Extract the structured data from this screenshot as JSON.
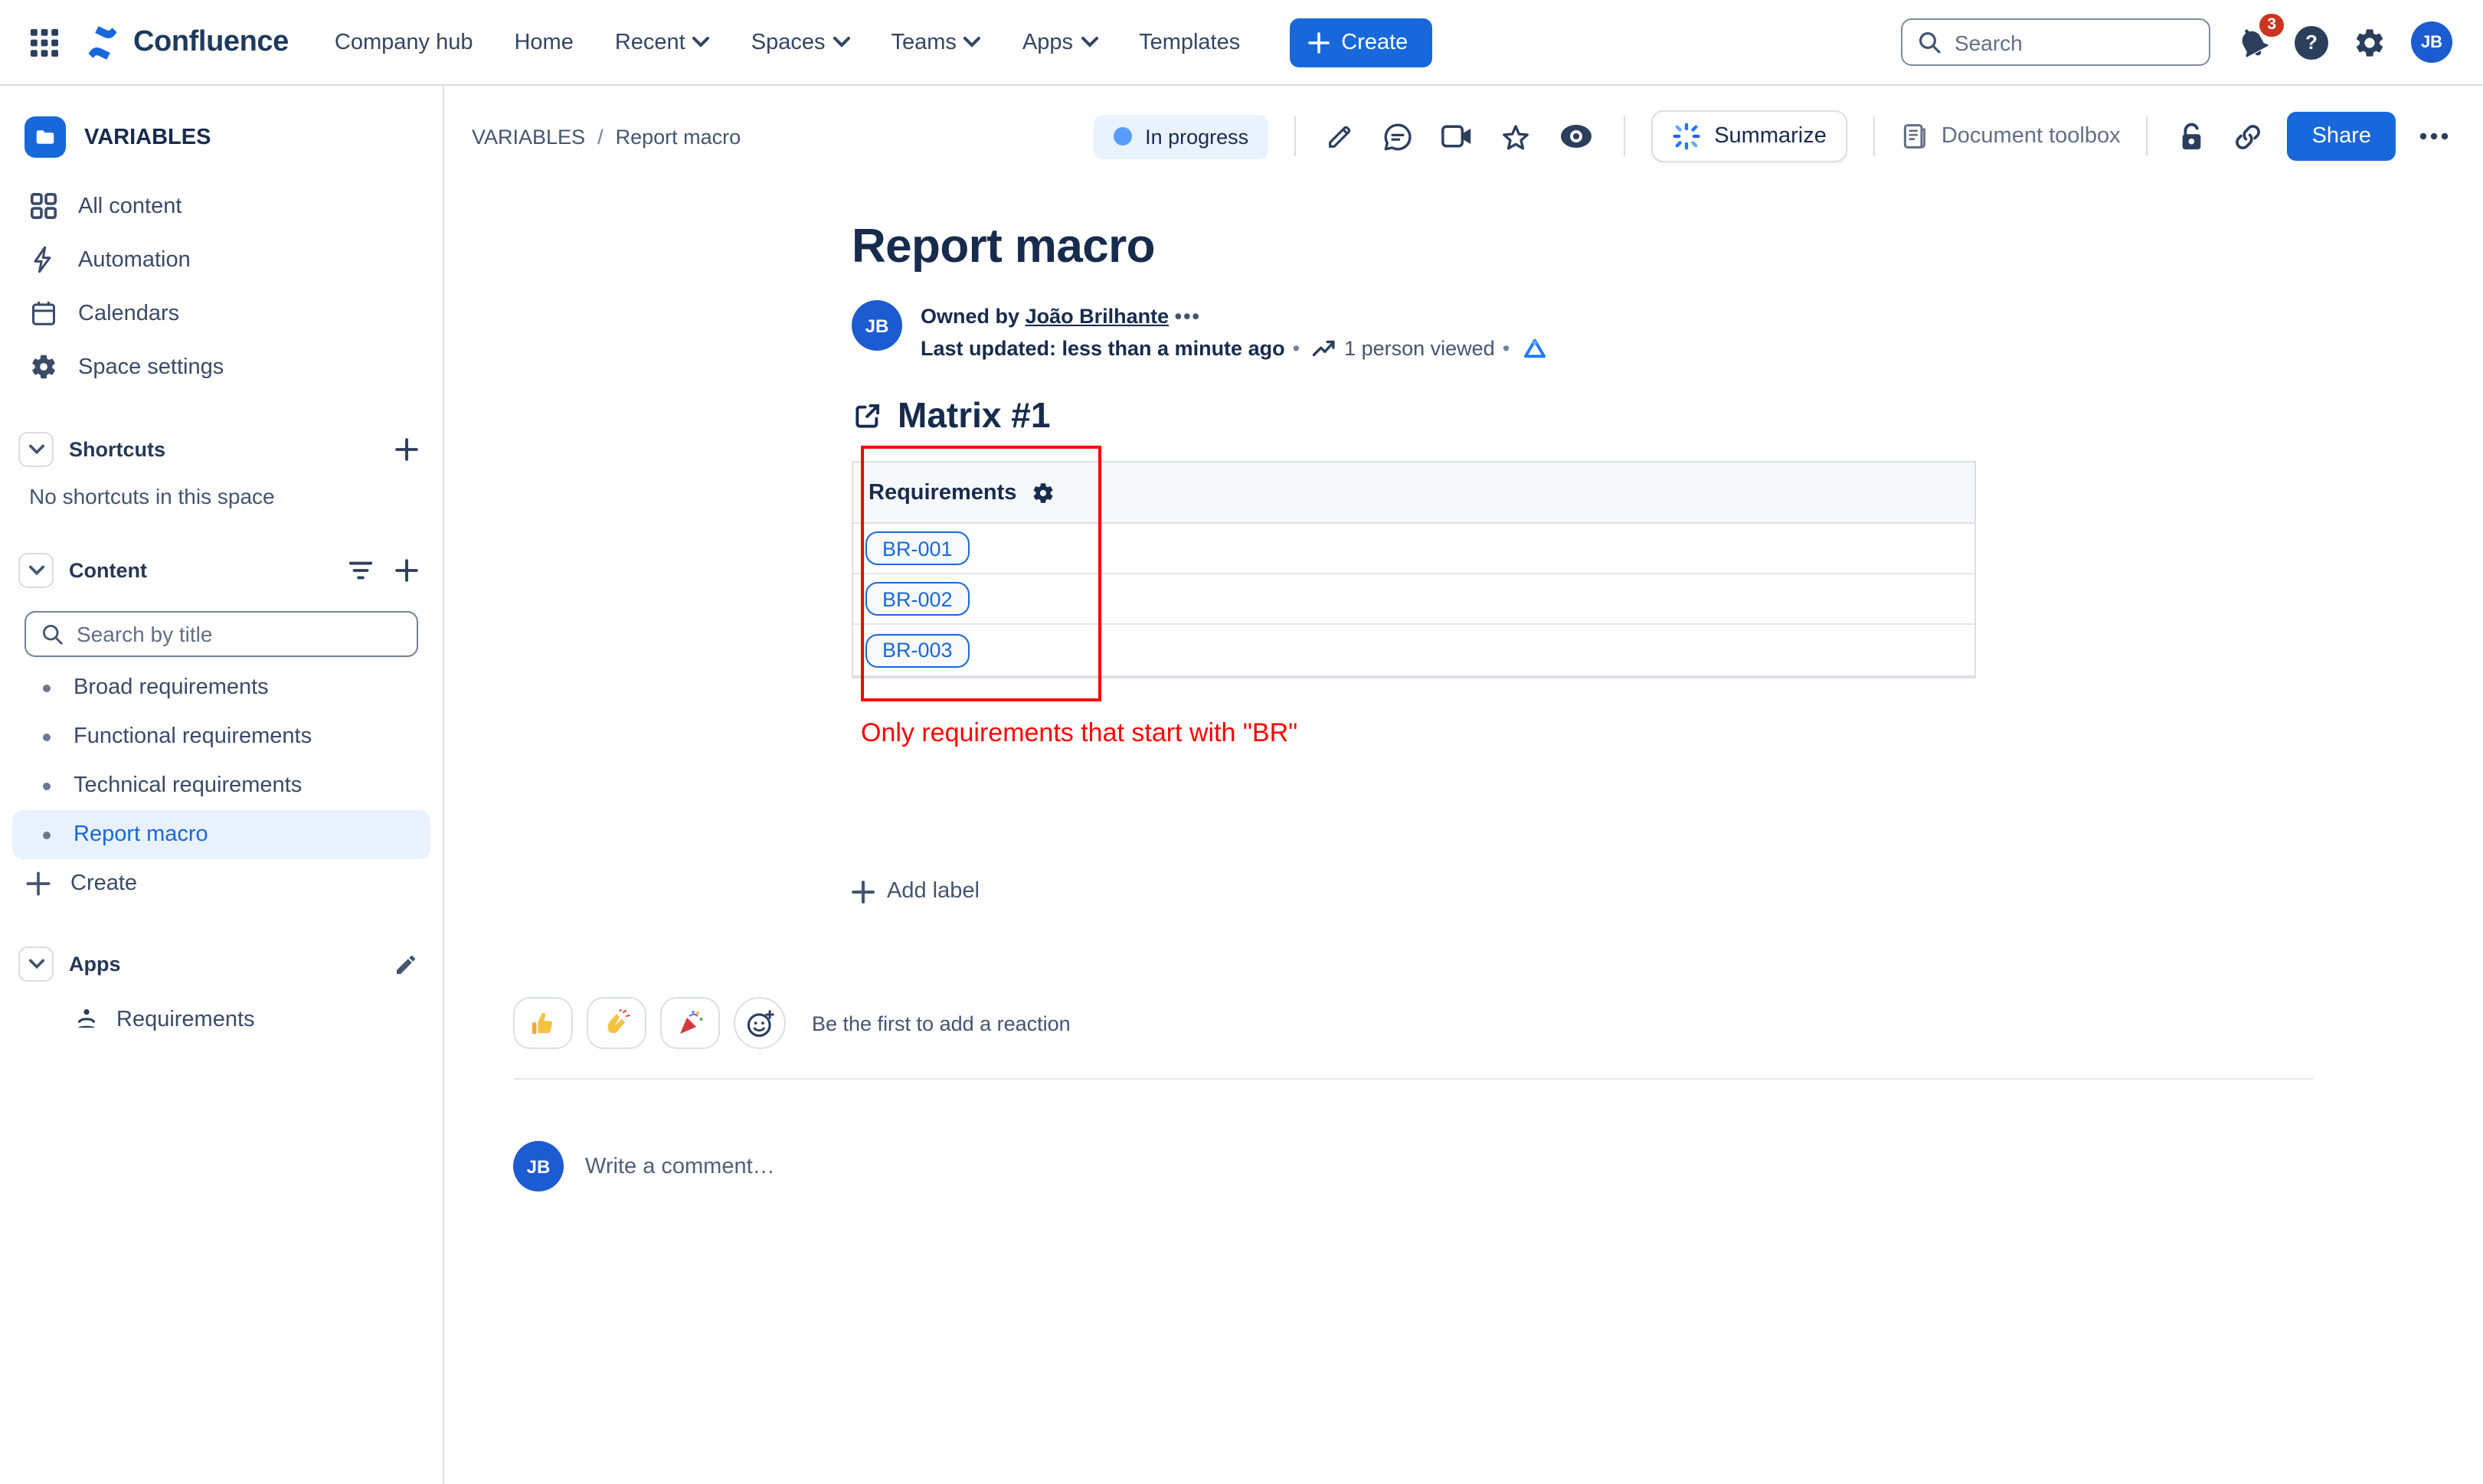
{
  "navbar": {
    "product": "Confluence",
    "items": [
      {
        "label": "Company hub",
        "chevron": false
      },
      {
        "label": "Home",
        "chevron": false
      },
      {
        "label": "Recent",
        "chevron": true
      },
      {
        "label": "Spaces",
        "chevron": true
      },
      {
        "label": "Teams",
        "chevron": true
      },
      {
        "label": "Apps",
        "chevron": true
      },
      {
        "label": "Templates",
        "chevron": false
      }
    ],
    "create_label": "Create",
    "search_placeholder": "Search",
    "notification_count": "3",
    "help_glyph": "?",
    "avatar_initials": "JB"
  },
  "sidebar": {
    "space_name": "VARIABLES",
    "nav_items": [
      {
        "label": "All content",
        "icon": "grid-icon"
      },
      {
        "label": "Automation",
        "icon": "bolt-icon"
      },
      {
        "label": "Calendars",
        "icon": "calendar-icon"
      },
      {
        "label": "Space settings",
        "icon": "gear-icon"
      }
    ],
    "shortcuts": {
      "title": "Shortcuts",
      "empty_text": "No shortcuts in this space"
    },
    "content_section": {
      "title": "Content",
      "search_placeholder": "Search by title",
      "pages": [
        {
          "label": "Broad requirements",
          "active": false
        },
        {
          "label": "Functional requirements",
          "active": false
        },
        {
          "label": "Technical requirements",
          "active": false
        },
        {
          "label": "Report macro",
          "active": true
        }
      ],
      "create_label": "Create"
    },
    "apps_section": {
      "title": "Apps",
      "items": [
        {
          "label": "Requirements",
          "icon": "meditation-icon"
        }
      ]
    }
  },
  "page_header": {
    "breadcrumb": {
      "space": "VARIABLES",
      "separator": "/",
      "page": "Report macro"
    },
    "status_label": "In progress",
    "summarize_label": "Summarize",
    "document_toolbox_label": "Document toolbox",
    "share_label": "Share"
  },
  "content": {
    "title": "Report macro",
    "byline": {
      "avatar_initials": "JB",
      "owned_by_prefix": "Owned by",
      "owner": "João Brilhante",
      "more_glyph": "•••",
      "last_updated": "Last updated: less than a minute ago",
      "views": "1 person viewed",
      "separator": "•"
    },
    "section_heading": "Matrix #1",
    "table": {
      "header": "Requirements",
      "rows": [
        {
          "label": "BR-001"
        },
        {
          "label": "BR-002"
        },
        {
          "label": "BR-003"
        }
      ]
    },
    "annotation_text": "Only requirements that start with \"BR\"",
    "add_label": "Add label"
  },
  "footer": {
    "reactions": [
      {
        "name": "thumbs-up"
      },
      {
        "name": "clap"
      },
      {
        "name": "party-popper"
      }
    ],
    "reaction_prompt": "Be the first to add a reaction",
    "comment_avatar_initials": "JB",
    "comment_placeholder": "Write a comment…"
  },
  "icons": {
    "app-switcher-icon": "3x3 dot grid",
    "confluence-logo-icon": "two blue chevrons",
    "search-icon": "magnifier",
    "notification-bell-icon": "bell",
    "settings-gear-icon": "gear",
    "edit-pencil-icon": "pencil",
    "comment-bubble-icon": "speech bubble",
    "video-icon": "camera",
    "star-icon": "star outline",
    "watch-eye-icon": "filled eye",
    "sparkle-icon": "blue burst",
    "doc-toolbox-icon": "document",
    "unlock-icon": "open padlock",
    "link-icon": "chain link",
    "more-icon": "ellipsis",
    "external-link-icon": "box with arrow",
    "trend-icon": "line chart",
    "analytics-icon": "blue triangle chart",
    "filter-icon": "funnel bars",
    "plus-icon": "plus",
    "chevron-down-icon": "chevron",
    "emoji-add-icon": "smiley with plus"
  },
  "colors": {
    "brand_blue": "#1868DB",
    "selected_bg": "#E9F2FF",
    "navy_text": "#172B4D",
    "status_dot": "#579DFF",
    "annotation_red": "#FF0000",
    "notification_badge": "#CA3521",
    "table_header_bg": "#F7F8F9",
    "border_gray": "#DCDFE4"
  }
}
